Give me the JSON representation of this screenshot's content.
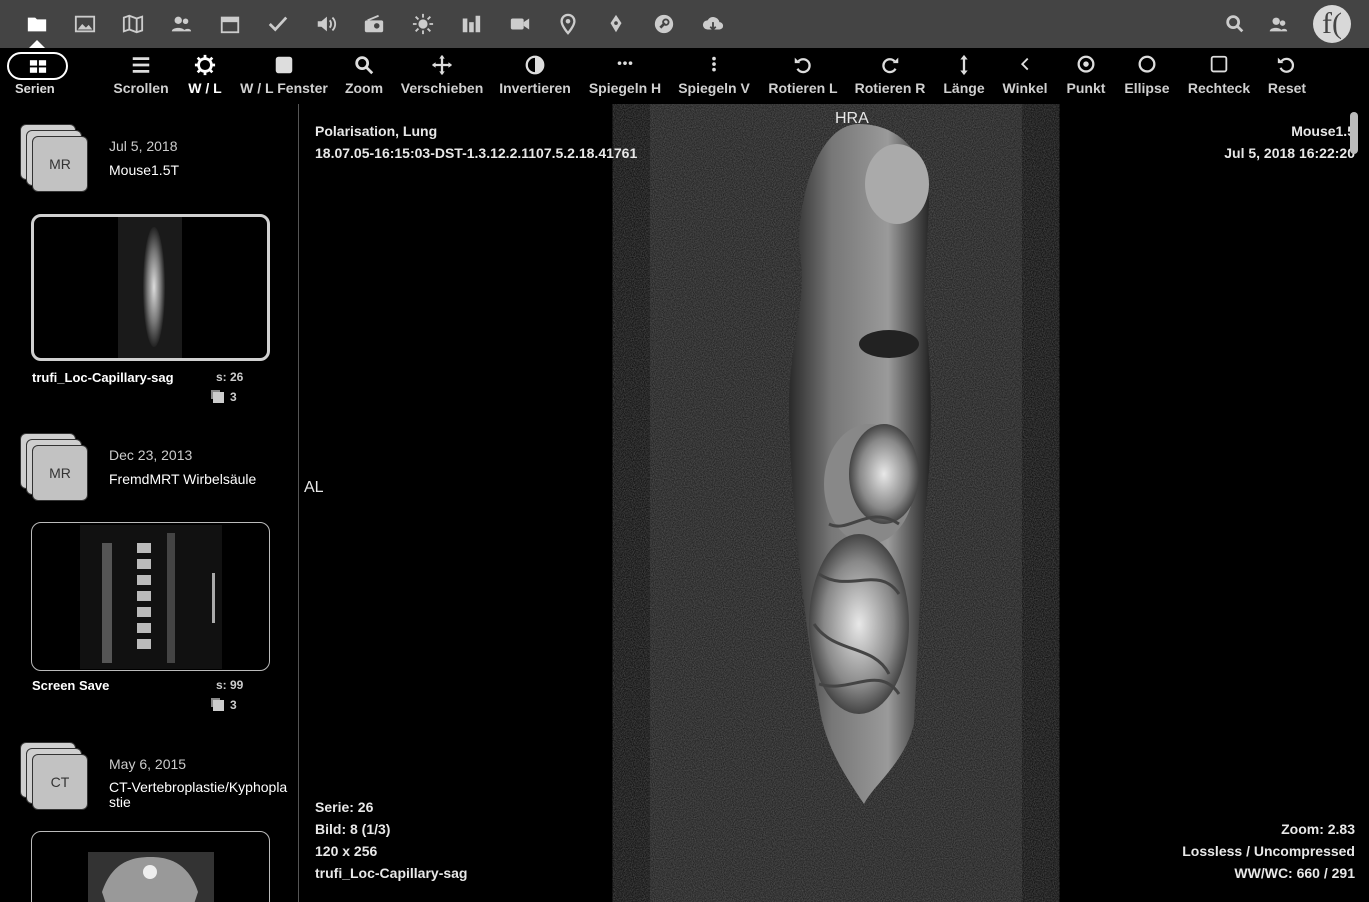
{
  "app_bar": {
    "icons": [
      "folder-icon",
      "image-icon",
      "map-icon",
      "users-icon",
      "calendar-icon",
      "check-icon",
      "speaker-icon",
      "radio-icon",
      "sun-icon",
      "bar-chart-icon",
      "video-icon",
      "location-pin-icon",
      "pen-nib-icon",
      "wrench-icon",
      "cloud-download-icon"
    ],
    "right_icons": [
      "search-icon",
      "user-icon"
    ],
    "logo_text": "f("
  },
  "toolbar": {
    "series_label": "Serien",
    "tools": [
      {
        "label": "Scrollen",
        "icon": "menu-icon"
      },
      {
        "label": "W / L",
        "icon": "gear-icon",
        "selected": true
      },
      {
        "label": "W / L Fenster",
        "icon": "square-filled-icon"
      },
      {
        "label": "Zoom",
        "icon": "zoom-icon"
      },
      {
        "label": "Verschieben",
        "icon": "move-icon"
      },
      {
        "label": "Invertieren",
        "icon": "invert-icon"
      },
      {
        "label": "Spiegeln H",
        "icon": "dots-horizontal-icon"
      },
      {
        "label": "Spiegeln V",
        "icon": "dots-vertical-icon"
      },
      {
        "label": "Rotieren L",
        "icon": "rotate-left-icon"
      },
      {
        "label": "Rotieren R",
        "icon": "rotate-right-icon"
      },
      {
        "label": "Länge",
        "icon": "length-icon"
      },
      {
        "label": "Winkel",
        "icon": "angle-icon"
      },
      {
        "label": "Punkt",
        "icon": "point-icon"
      },
      {
        "label": "Ellipse",
        "icon": "ellipse-icon"
      },
      {
        "label": "Rechteck",
        "icon": "rectangle-icon"
      },
      {
        "label": "Reset",
        "icon": "reset-icon"
      }
    ]
  },
  "studies": [
    {
      "modality": "MR",
      "date": "Jul 5, 2018",
      "name": "Mouse1.5T",
      "series": {
        "name": "trufi_Loc-Capillary-sag",
        "s": "s: 26",
        "count": "3",
        "selected": true
      }
    },
    {
      "modality": "MR",
      "date": "Dec 23, 2013",
      "name": "FremdMRT Wirbelsäule",
      "series": {
        "name": "Screen Save",
        "s": "s: 99",
        "count": "3",
        "selected": false
      }
    },
    {
      "modality": "CT",
      "date": "May 6, 2015",
      "name": "CT-Vertebroplastie/Kyphoplastie"
    }
  ],
  "viewer": {
    "top_left": [
      "Polarisation, Lung",
      "18.07.05-16:15:03-DST-1.3.12.2.1107.5.2.18.41761"
    ],
    "top_right": [
      "Mouse1.5",
      "Jul 5, 2018 16:22:20"
    ],
    "orientation_top": "HRA",
    "orientation_left": "AL",
    "bottom_left": [
      "Serie: 26",
      "Bild: 8 (1/3)",
      "120 x 256",
      "trufi_Loc-Capillary-sag"
    ],
    "bottom_right": [
      "Zoom: 2.83",
      "Lossless / Uncompressed",
      "WW/WC: 660 / 291"
    ]
  }
}
